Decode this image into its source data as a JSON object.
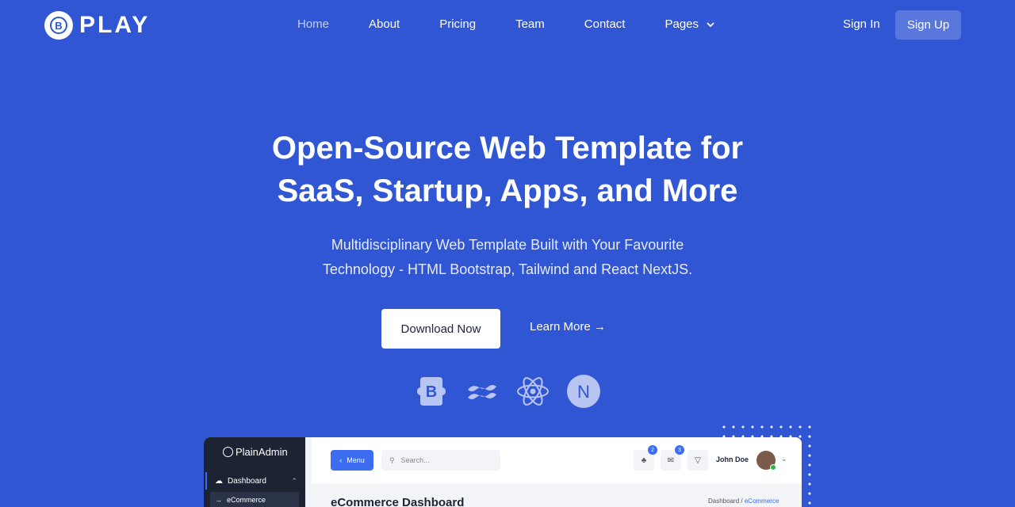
{
  "header": {
    "logo_letter": "B",
    "logo_text": "PLAY",
    "nav": [
      "Home",
      "About",
      "Pricing",
      "Team",
      "Contact",
      "Pages"
    ],
    "sign_in": "Sign In",
    "sign_up": "Sign Up"
  },
  "hero": {
    "title_line1": "Open-Source Web Template for",
    "title_line2": "SaaS, Startup, Apps, and More",
    "subtitle_line1": "Multidisciplinary Web Template Built with Your Favourite",
    "subtitle_line2": "Technology - HTML Bootstrap, Tailwind and React NextJS.",
    "download_label": "Download Now",
    "learn_label": "Learn More →",
    "tech_icons": [
      "bootstrap-icon",
      "tailwind-icon",
      "react-icon",
      "nextjs-icon"
    ]
  },
  "preview": {
    "brand": "PlainAdmin",
    "sidebar_dashboard": "Dashboard",
    "sidebar_ecommerce": "eCommerce",
    "menu_label": "Menu",
    "search_placeholder": "Search...",
    "notif_count": "2",
    "mail_count": "3",
    "user_name": "John Doe",
    "page_title": "eCommerce Dashboard",
    "crumb_root": "Dashboard",
    "crumb_sep": "/",
    "crumb_current": "eCommerce"
  },
  "colors": {
    "background": "#3056d3",
    "sign_up_bg": "#5a78dc",
    "accent": "#3c6df1"
  }
}
